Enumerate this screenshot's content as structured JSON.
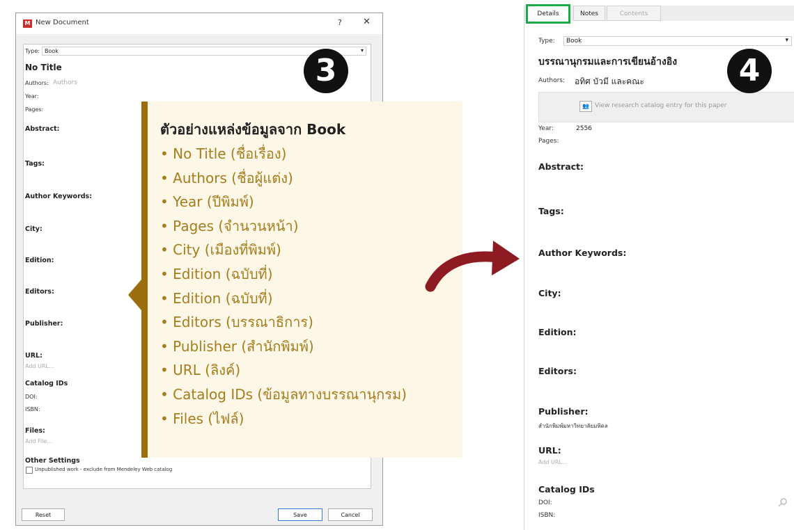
{
  "dialog": {
    "title": "New Document",
    "help": "?",
    "close": "✕",
    "type_label": "Type:",
    "type_value": "Book",
    "doc_title": "No Title",
    "authors_label": "Authors:",
    "authors_placeholder": "Authors",
    "year_label": "Year:",
    "pages_label": "Pages:",
    "abstract": "Abstract:",
    "tags": "Tags:",
    "author_keywords": "Author Keywords:",
    "city": "City:",
    "edition": "Edition:",
    "editors": "Editors:",
    "publisher": "Publisher:",
    "url": "URL:",
    "url_placeholder": "Add URL...",
    "catalog_ids": "Catalog IDs",
    "doi": "DOI:",
    "isbn": "ISBN:",
    "files": "Files:",
    "files_placeholder": "Add File...",
    "other_settings": "Other Settings",
    "unpublished": "Unpublished work - exclude from Mendeley Web catalog",
    "reset": "Reset",
    "save": "Save",
    "cancel": "Cancel"
  },
  "badges": {
    "left": "3",
    "right": "4"
  },
  "callout": {
    "heading": "ตัวอย่างแหล่งข้อมูลจาก Book",
    "items": [
      "• No Title (ชื่อเรื่อง)",
      "• Authors (ชื่อผู้แต่ง)",
      "• Year (ปีพิมพ์)",
      "• Pages (จำนวนหน้า)",
      "• City (เมืองที่พิมพ์)",
      "• Edition (ฉบับที่)",
      "• Edition (ฉบับที่)",
      "• Editors (บรรณาธิการ)",
      "• Publisher (สำนักพิมพ์)",
      "• URL (ลิงค์)",
      "• Catalog IDs (ข้อมูลทางบรรณานุกรม)",
      "• Files (ไฟล์)"
    ]
  },
  "panel": {
    "tabs": [
      "Details",
      "Notes",
      "Contents"
    ],
    "type_label": "Type:",
    "type_value": "Book",
    "doc_title": "บรรณานุกรมและการเขียนอ้างอิง",
    "authors_label": "Authors:",
    "authors_value": "อทิศ บัวมี และคณะ",
    "catalog_link": "View research catalog entry for this paper",
    "year_label": "Year:",
    "year_value": "2556",
    "pages_label": "Pages:",
    "abstract": "Abstract:",
    "tags": "Tags:",
    "author_keywords": "Author Keywords:",
    "city": "City:",
    "edition": "Edition:",
    "editors": "Editors:",
    "publisher": "Publisher:",
    "publisher_value": "สำนักพิมพ์มหาวิทยาลัยมหิดล",
    "url": "URL:",
    "url_placeholder": "Add URL...",
    "catalog_ids": "Catalog IDs",
    "doi": "DOI:",
    "isbn": "ISBN:"
  },
  "colors": {
    "callout_bar": "#9b6e0d",
    "callout_text": "#a57d1e",
    "arrow": "#8e1b22",
    "tab_highlight": "#1aaa47"
  }
}
